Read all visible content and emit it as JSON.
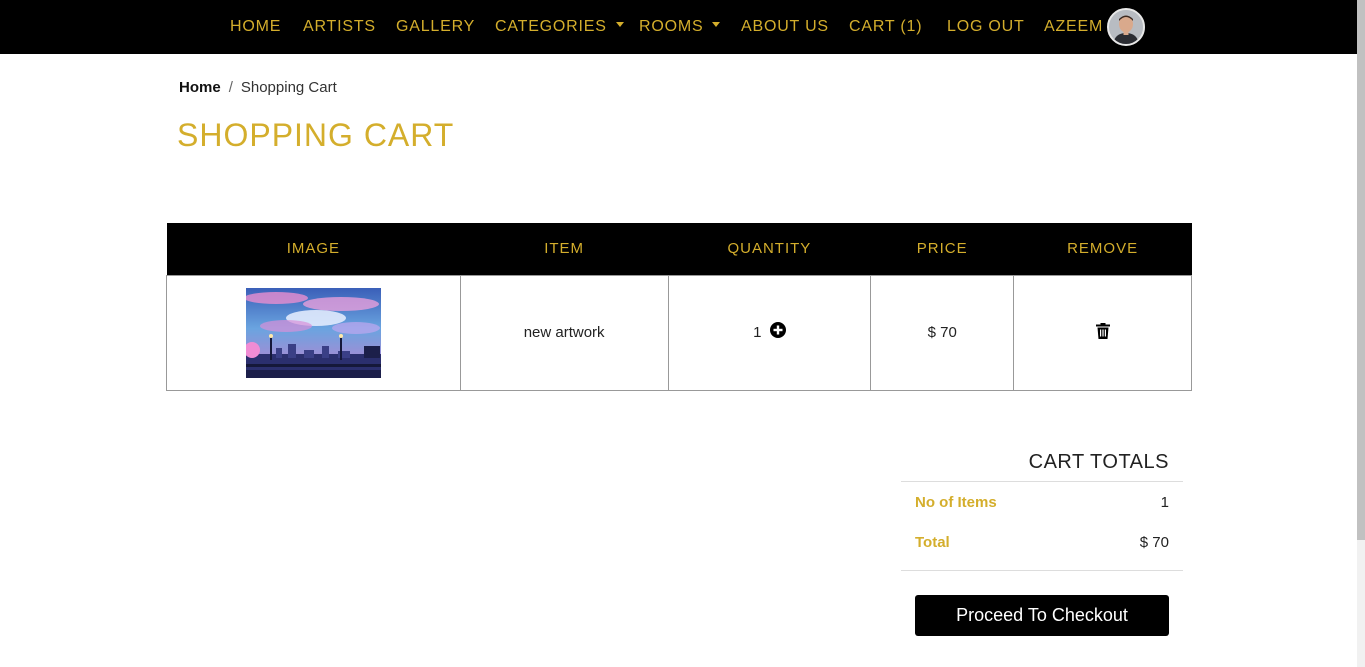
{
  "nav": {
    "items": [
      {
        "label": "HOME"
      },
      {
        "label": "ARTISTS"
      },
      {
        "label": "GALLERY"
      },
      {
        "label": "CATEGORIES"
      },
      {
        "label": "ROOMS"
      },
      {
        "label": "ABOUT US"
      },
      {
        "label": "CART (1)"
      },
      {
        "label": "LOG OUT"
      },
      {
        "label": "AZEEM"
      }
    ]
  },
  "breadcrumb": {
    "home": "Home",
    "separator": "/",
    "current": "Shopping Cart"
  },
  "page": {
    "title": "SHOPPING CART"
  },
  "table": {
    "headers": [
      "IMAGE",
      "ITEM",
      "QUANTITY",
      "PRICE",
      "REMOVE"
    ],
    "rows": [
      {
        "item": "new artwork",
        "quantity": "1",
        "price": "$ 70",
        "image_icon": "artwork-thumbnail",
        "add_icon": "plus-circle-icon",
        "remove_icon": "trash-icon"
      }
    ]
  },
  "totals": {
    "title": "CART TOTALS",
    "items_label": "No of Items",
    "items_value": "1",
    "total_label": "Total",
    "total_value": "$ 70",
    "checkout_label": "Proceed To Checkout"
  },
  "colors": {
    "accent": "#d4ae2c",
    "nav_bg": "#000000",
    "button_bg": "#000000"
  }
}
